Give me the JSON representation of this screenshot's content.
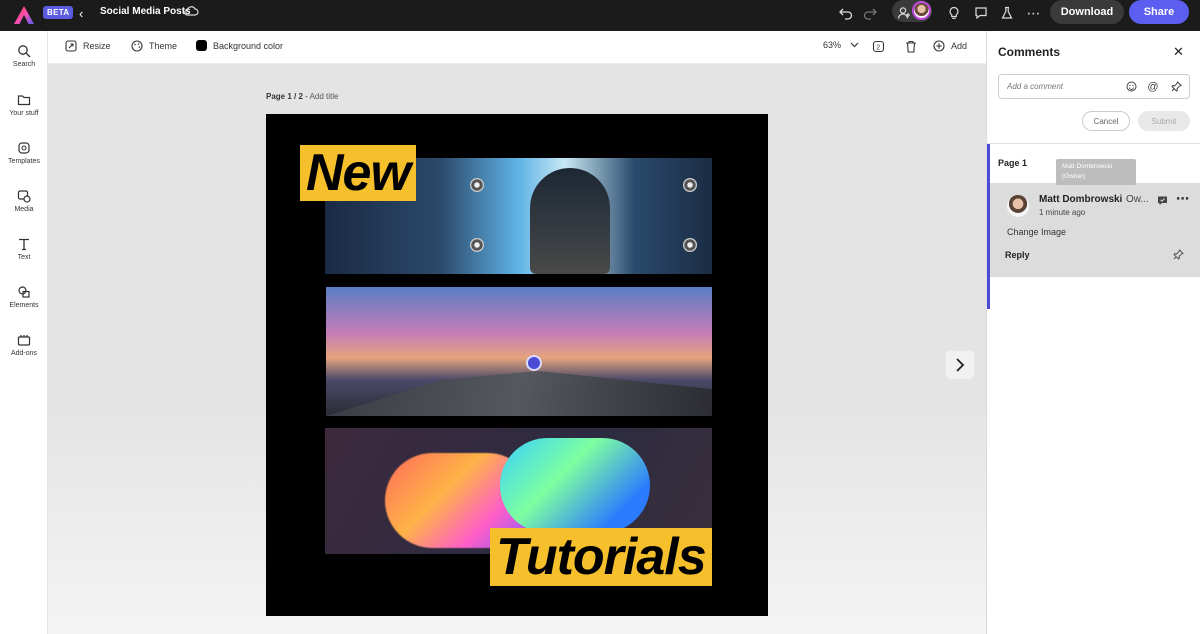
{
  "topbar": {
    "beta": "BETA",
    "doc_title": "Social Media Posts",
    "download_label": "Download",
    "share_label": "Share"
  },
  "rail": [
    {
      "label": "Search",
      "icon": "search-icon"
    },
    {
      "label": "Your stuff",
      "icon": "folder-icon"
    },
    {
      "label": "Templates",
      "icon": "templates-icon"
    },
    {
      "label": "Media",
      "icon": "media-icon"
    },
    {
      "label": "Text",
      "icon": "text-icon"
    },
    {
      "label": "Elements",
      "icon": "elements-icon"
    },
    {
      "label": "Add-ons",
      "icon": "addons-icon"
    }
  ],
  "toolbar": {
    "resize": "Resize",
    "theme": "Theme",
    "background_color": "Background color",
    "zoom": "63%",
    "add": "Add"
  },
  "canvas": {
    "page_indicator": "Page 1 / 2",
    "separator": " - ",
    "add_title": "Add title",
    "headline_top": "New",
    "headline_bottom": "Tutorials"
  },
  "comments": {
    "title": "Comments",
    "placeholder": "Add a comment",
    "cancel": "Cancel",
    "submit": "Submit",
    "page_label": "Page 1",
    "tooltip_name": "Matt Dombrowski",
    "tooltip_role": "(Owner)",
    "author": "Matt Dombrowski",
    "author_role_truncated": "Ow...",
    "time": "1 minute ago",
    "body": "Change Image",
    "reply": "Reply"
  },
  "colors": {
    "accent": "#5b5ef0",
    "highlight_label": "#f5c02b",
    "selection_bar": "#4b4bd6"
  }
}
